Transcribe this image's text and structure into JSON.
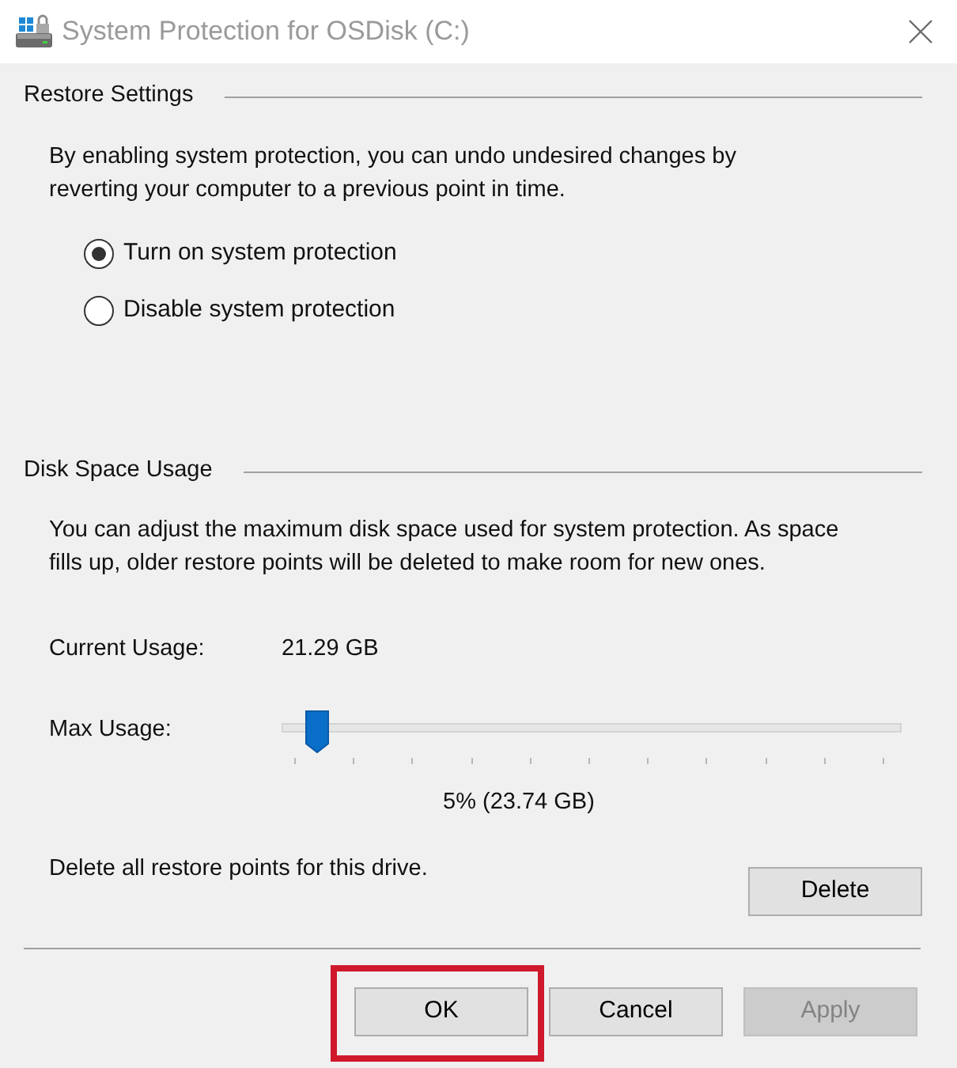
{
  "window": {
    "title": "System Protection for OSDisk (C:)"
  },
  "restore_settings": {
    "heading": "Restore Settings",
    "description": "By enabling system protection, you can undo undesired changes by reverting your computer to a previous point in time.",
    "options": [
      {
        "label": "Turn on system protection",
        "selected": true
      },
      {
        "label": "Disable system protection",
        "selected": false
      }
    ]
  },
  "disk_space_usage": {
    "heading": "Disk Space Usage",
    "description": "You can adjust the maximum disk space used for system protection. As space fills up, older restore points will be deleted to make room for new ones.",
    "current_usage": {
      "label": "Current Usage:",
      "value": "21.29 GB"
    },
    "max_usage": {
      "label": "Max Usage:",
      "level": 0.04,
      "reading": "5% (23.74 GB)"
    },
    "delete": {
      "label": "Delete all restore points for this drive.",
      "button": "Delete"
    }
  },
  "buttons": [
    {
      "label": "OK",
      "highlighted": true,
      "disabled": false
    },
    {
      "label": "Cancel",
      "highlighted": false,
      "disabled": false
    },
    {
      "label": "Apply",
      "highlighted": false,
      "disabled": true
    }
  ]
}
